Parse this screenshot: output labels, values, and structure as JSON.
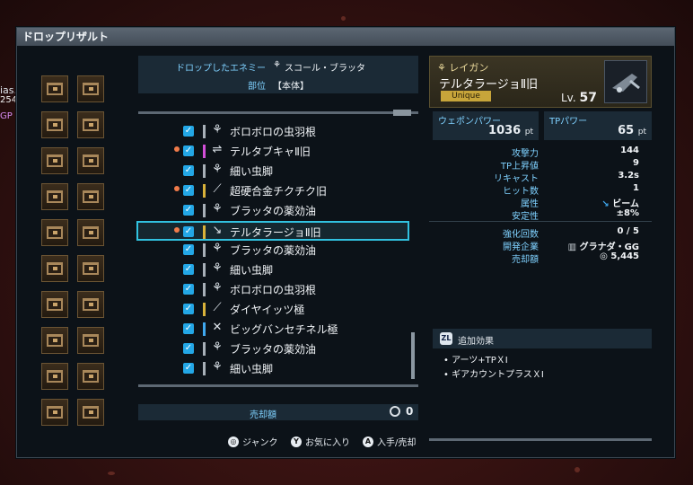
{
  "window": {
    "title": "ドロップリザルト"
  },
  "side_fragments": {
    "line1": "ias.",
    "line2": "254",
    "line3": "GP 2"
  },
  "enemy": {
    "enemy_label": "ドロップしたエネミー",
    "enemy_value": "スコール・ブラッタ",
    "part_label": "部位",
    "part_value": "【本体】"
  },
  "items": [
    {
      "name": "ボロボロの虫羽根",
      "new": false,
      "bar_color": "#a8b0b8",
      "icon": "bug-material-icon"
    },
    {
      "name": "テルタブキャⅡ旧",
      "new": true,
      "bar_color": "#d24fd8",
      "icon": "rifle-icon"
    },
    {
      "name": "細い虫脚",
      "new": false,
      "bar_color": "#a8b0b8",
      "icon": "bug-material-icon"
    },
    {
      "name": "超硬合金チクチク旧",
      "new": true,
      "bar_color": "#d9b23a",
      "icon": "knife-icon"
    },
    {
      "name": "ブラッタの薬効油",
      "new": false,
      "bar_color": "#a8b0b8",
      "icon": "bug-material-icon"
    },
    {
      "name": "テルタラージョⅡ旧",
      "new": true,
      "bar_color": "#d9b23a",
      "icon": "launcher-icon",
      "selected": true
    },
    {
      "name": "ブラッタの薬効油",
      "new": false,
      "bar_color": "#a8b0b8",
      "icon": "bug-material-icon"
    },
    {
      "name": "細い虫脚",
      "new": false,
      "bar_color": "#a8b0b8",
      "icon": "bug-material-icon"
    },
    {
      "name": "ボロボロの虫羽根",
      "new": false,
      "bar_color": "#a8b0b8",
      "icon": "bug-material-icon"
    },
    {
      "name": "ダイヤイッツ極",
      "new": false,
      "bar_color": "#d9b23a",
      "icon": "wand-icon"
    },
    {
      "name": "ビッグバンセチネル極",
      "new": false,
      "bar_color": "#3fa8ef",
      "icon": "sword-icon"
    },
    {
      "name": "ブラッタの薬効油",
      "new": false,
      "bar_color": "#a8b0b8",
      "icon": "bug-material-icon"
    },
    {
      "name": "細い虫脚",
      "new": false,
      "bar_color": "#a8b0b8",
      "icon": "bug-material-icon"
    }
  ],
  "sale": {
    "label": "売却額",
    "value": "0"
  },
  "footer": {
    "jank": "ジャンク",
    "fav_key": "Y",
    "fav": "お気に入り",
    "get_key": "A",
    "get": "入手/売却"
  },
  "weapon": {
    "type": "レイガン",
    "name": "テルタラージョⅡ旧",
    "rarity": "Unique",
    "lv_label": "Lv.",
    "lv_value": "57",
    "power_label": "ウェポンパワー",
    "power_value": "1036",
    "power_unit": "pt",
    "tp_label": "TPパワー",
    "tp_value": "65",
    "tp_unit": "pt"
  },
  "stats": [
    {
      "k": "攻撃力",
      "v": "144"
    },
    {
      "k": "TP上昇値",
      "v": "9"
    },
    {
      "k": "リキャスト",
      "v": "3.2s"
    },
    {
      "k": "ヒット数",
      "v": "1"
    },
    {
      "k": "属性",
      "v": "ビーム"
    },
    {
      "k": "安定性",
      "v": "±8%"
    }
  ],
  "stats2": [
    {
      "k": "強化回数",
      "v": "0 / 5"
    },
    {
      "k": "開発企業",
      "v": "グラナダ・GG"
    },
    {
      "k": "売却額",
      "v": "5,445"
    }
  ],
  "extra": {
    "zl": "ZL",
    "title": "追加効果",
    "items": [
      "アーツ+TPＸⅠ",
      "ギアカウントプラスＸⅠ"
    ]
  }
}
